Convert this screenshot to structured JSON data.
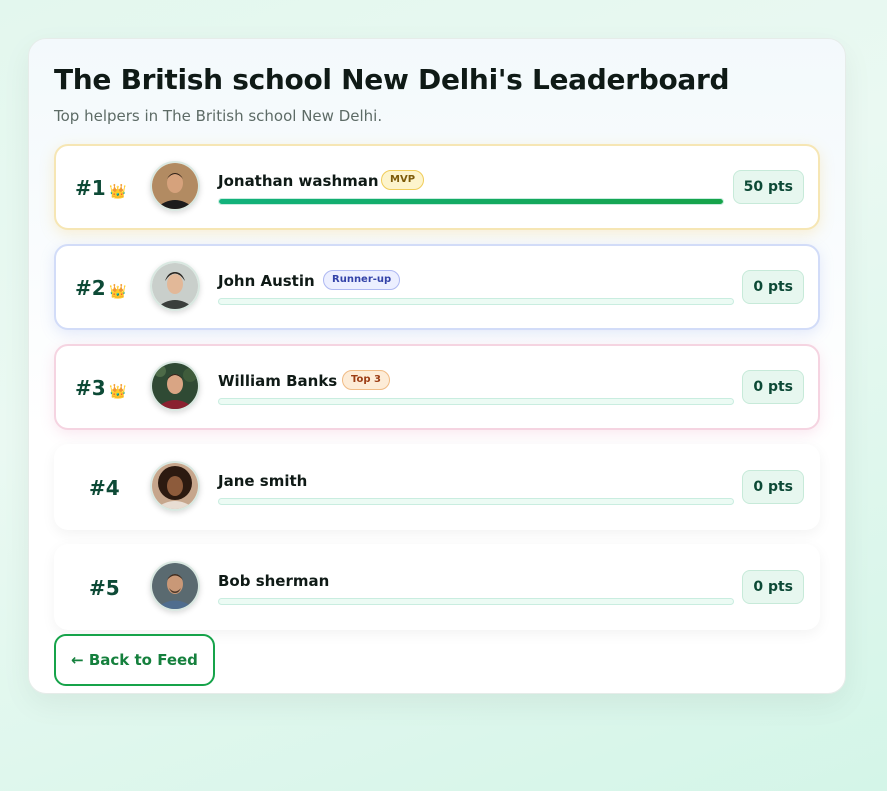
{
  "header": {
    "title": "The British school New Delhi's Leaderboard",
    "subtitle": "Top helpers in The British school New Delhi."
  },
  "leaders": [
    {
      "rank": "#1",
      "name": "Jonathan washman",
      "badge": "MVP",
      "points": "50 pts",
      "progress": 1.0,
      "crown": "👑"
    },
    {
      "rank": "#2",
      "name": "John Austin",
      "badge": "Runner-up",
      "points": "0 pts",
      "progress": 0,
      "crown": "👑"
    },
    {
      "rank": "#3",
      "name": "William Banks",
      "badge": "Top 3",
      "points": "0 pts",
      "progress": 0,
      "crown": "👑"
    },
    {
      "rank": "#4",
      "name": "Jane smith",
      "points": "0 pts",
      "progress": 0
    },
    {
      "rank": "#5",
      "name": "Bob sherman",
      "points": "0 pts",
      "progress": 0
    }
  ],
  "footer": {
    "back_label": "← Back to Feed"
  },
  "colors": {
    "accent": "#16a34a",
    "rank_text": "#0d4a36"
  }
}
